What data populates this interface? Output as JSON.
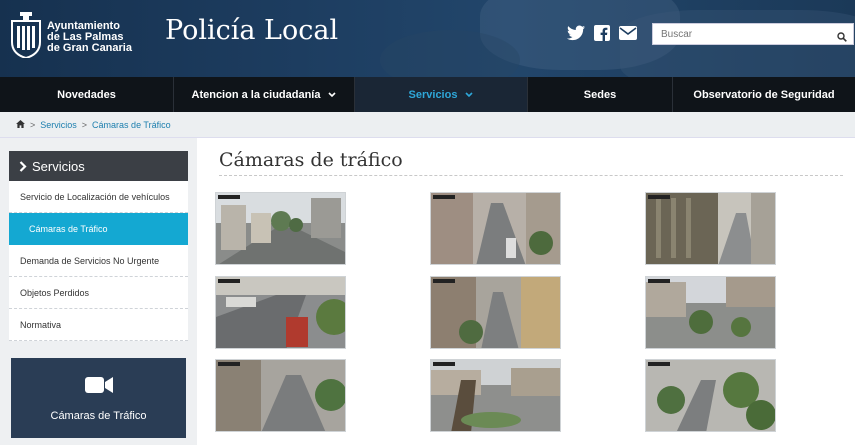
{
  "header": {
    "org_line1": "Ayuntamiento",
    "org_line2": "de Las Palmas",
    "org_line3": "de Gran Canaria",
    "site_title": "Policía Local",
    "social_icons": [
      "twitter-icon",
      "facebook-icon",
      "email-icon"
    ],
    "search_placeholder": "Buscar"
  },
  "nav": {
    "items": [
      {
        "label": "Novedades"
      },
      {
        "label": "Atencion a la ciudadanía"
      },
      {
        "label": "Servicios"
      },
      {
        "label": "Sedes"
      },
      {
        "label": "Observatorio de Seguridad"
      }
    ],
    "active_index": 2
  },
  "breadcrumb": {
    "home_icon": "home-icon",
    "items": [
      "Servicios",
      "Cámaras de Tráfico"
    ]
  },
  "sidebar": {
    "title": "Servicios",
    "items": [
      {
        "label": "Servicio de Localización de vehículos"
      },
      {
        "label": "Cámaras de Tráfico"
      },
      {
        "label": "Demanda de Servicios No Urgente"
      },
      {
        "label": "Objetos Perdidos"
      },
      {
        "label": "Normativa"
      }
    ],
    "active_index": 1,
    "card_label": "Cámaras de Tráfico",
    "card_icon": "video-camera-icon"
  },
  "main": {
    "title": "Cámaras de tráfico",
    "camera_count": 9
  },
  "colors": {
    "header_bg": "#1d3d60",
    "nav_bg": "#0f1419",
    "active_nav_text": "#2ea7d9",
    "active_side_bg": "#14a8d2",
    "card_bg": "#2a3d55",
    "link": "#1d7fae"
  }
}
